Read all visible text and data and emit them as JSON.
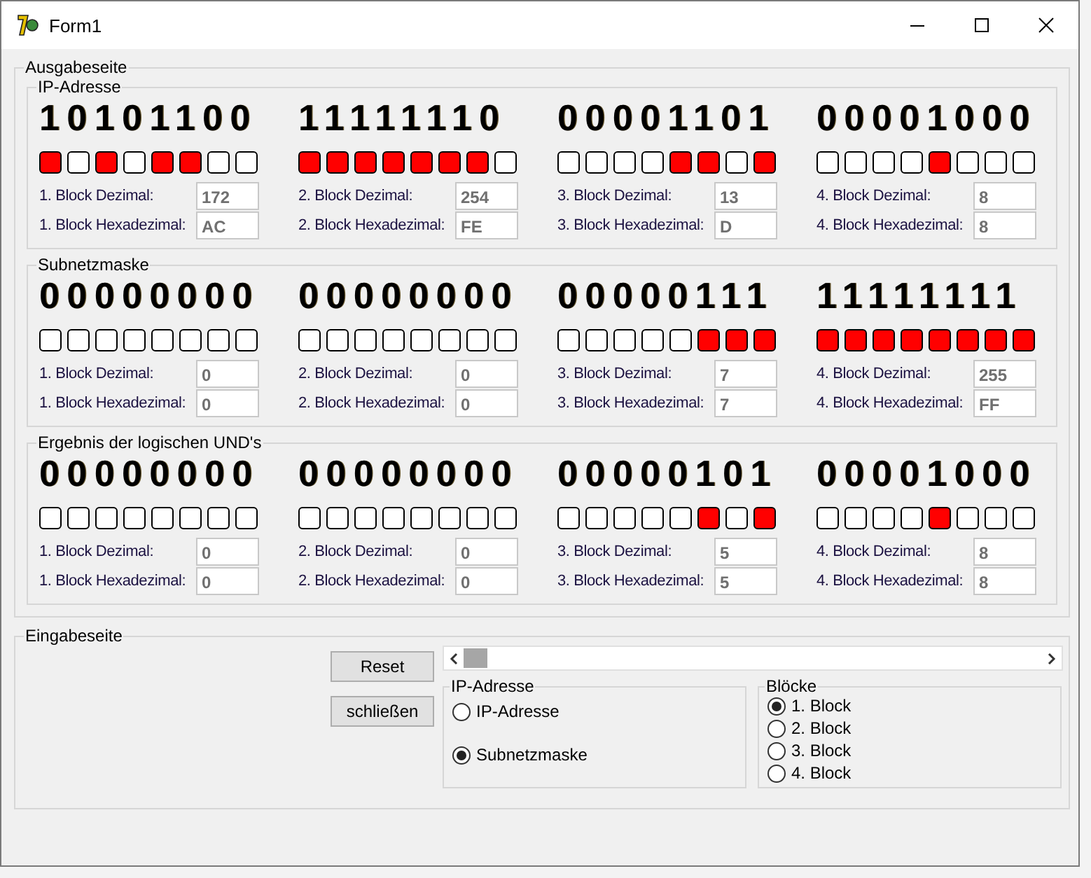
{
  "window": {
    "title": "Form1"
  },
  "output": {
    "title": "Ausgabeseite",
    "groups": [
      {
        "title": "IP-Adresse",
        "blocks": [
          {
            "bits": "10101100",
            "lamps": [
              true,
              false,
              true,
              false,
              true,
              true,
              false,
              false
            ],
            "dec_label": "1. Block Dezimal:",
            "dec": "172",
            "hex_label": "1. Block Hexadezimal:",
            "hex": "AC"
          },
          {
            "bits": "11111110",
            "lamps": [
              true,
              true,
              true,
              true,
              true,
              true,
              true,
              false
            ],
            "dec_label": "2. Block Dezimal:",
            "dec": "254",
            "hex_label": "2. Block Hexadezimal:",
            "hex": "FE"
          },
          {
            "bits": "00001101",
            "lamps": [
              false,
              false,
              false,
              false,
              true,
              true,
              false,
              true
            ],
            "dec_label": "3. Block Dezimal:",
            "dec": "13",
            "hex_label": "3. Block Hexadezimal:",
            "hex": "D"
          },
          {
            "bits": "00001000",
            "lamps": [
              false,
              false,
              false,
              false,
              true,
              false,
              false,
              false
            ],
            "dec_label": "4. Block Dezimal:",
            "dec": "8",
            "hex_label": "4. Block Hexadezimal:",
            "hex": "8"
          }
        ]
      },
      {
        "title": "Subnetzmaske",
        "blocks": [
          {
            "bits": "00000000",
            "lamps": [
              false,
              false,
              false,
              false,
              false,
              false,
              false,
              false
            ],
            "dec_label": "1. Block Dezimal:",
            "dec": "0",
            "hex_label": "1. Block Hexadezimal:",
            "hex": "0"
          },
          {
            "bits": "00000000",
            "lamps": [
              false,
              false,
              false,
              false,
              false,
              false,
              false,
              false
            ],
            "dec_label": "2. Block Dezimal:",
            "dec": "0",
            "hex_label": "2. Block Hexadezimal:",
            "hex": "0"
          },
          {
            "bits": "00000111",
            "lamps": [
              false,
              false,
              false,
              false,
              false,
              true,
              true,
              true
            ],
            "dec_label": "3. Block Dezimal:",
            "dec": "7",
            "hex_label": "3. Block Hexadezimal:",
            "hex": "7"
          },
          {
            "bits": "11111111",
            "lamps": [
              true,
              true,
              true,
              true,
              true,
              true,
              true,
              true
            ],
            "dec_label": "4. Block Dezimal:",
            "dec": "255",
            "hex_label": "4. Block Hexadezimal:",
            "hex": "FF"
          }
        ]
      },
      {
        "title": "Ergebnis der logischen UND's",
        "blocks": [
          {
            "bits": "00000000",
            "lamps": [
              false,
              false,
              false,
              false,
              false,
              false,
              false,
              false
            ],
            "dec_label": "1. Block Dezimal:",
            "dec": "0",
            "hex_label": "1. Block Hexadezimal:",
            "hex": "0"
          },
          {
            "bits": "00000000",
            "lamps": [
              false,
              false,
              false,
              false,
              false,
              false,
              false,
              false
            ],
            "dec_label": "2. Block Dezimal:",
            "dec": "0",
            "hex_label": "2. Block Hexadezimal:",
            "hex": "0"
          },
          {
            "bits": "00000101",
            "lamps": [
              false,
              false,
              false,
              false,
              false,
              true,
              false,
              true
            ],
            "dec_label": "3. Block Dezimal:",
            "dec": "5",
            "hex_label": "3. Block Hexadezimal:",
            "hex": "5"
          },
          {
            "bits": "00001000",
            "lamps": [
              false,
              false,
              false,
              false,
              true,
              false,
              false,
              false
            ],
            "dec_label": "4. Block Dezimal:",
            "dec": "8",
            "hex_label": "4. Block Hexadezimal:",
            "hex": "8"
          }
        ]
      }
    ]
  },
  "input": {
    "title": "Eingabeseite",
    "buttons": [
      "Reset",
      "schließen"
    ],
    "mode_group": {
      "title": "IP-Adresse",
      "options": [
        {
          "label": "IP-Adresse",
          "selected": false
        },
        {
          "label": "Subnetzmaske",
          "selected": true
        }
      ]
    },
    "block_group": {
      "title": "Blöcke",
      "options": [
        {
          "label": "1. Block",
          "selected": true
        },
        {
          "label": "2. Block",
          "selected": false
        },
        {
          "label": "3. Block",
          "selected": false
        },
        {
          "label": "4. Block",
          "selected": false
        }
      ]
    }
  }
}
